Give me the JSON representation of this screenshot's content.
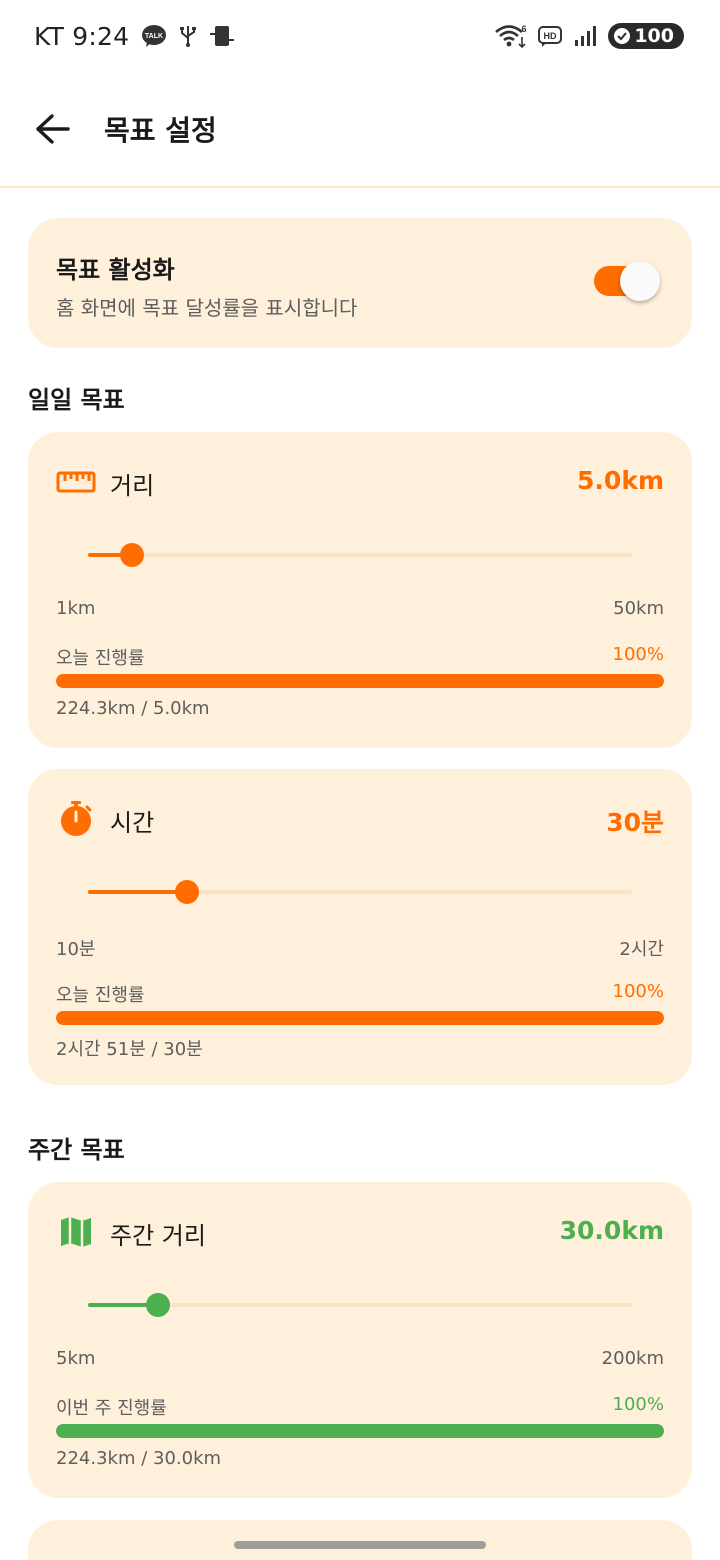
{
  "status_bar": {
    "time": "KT 9:24",
    "battery": "100",
    "network_badge": "HD",
    "wifi_superscript": "6",
    "icons": [
      "kakaotalk-icon",
      "usb-icon",
      "screen-cast-icon",
      "wifi-icon",
      "hd-voice-icon",
      "signal-icon",
      "battery-icon"
    ]
  },
  "app_bar": {
    "title": "목표 설정",
    "back_icon": "arrow-left-icon"
  },
  "toggle": {
    "title": "목표 활성화",
    "description": "홈 화면에 목표 달성률을 표시합니다",
    "enabled": true
  },
  "sections": {
    "daily_title": "일일 목표",
    "weekly_title": "주간 목표"
  },
  "colors": {
    "accent": "#ff6d00",
    "weekly": "#4caf50",
    "card_bg": "#fff0db",
    "track": "#fde4c0"
  },
  "goals": [
    {
      "icon": "ruler-icon",
      "label": "거리",
      "value": "5.0km",
      "slider_fraction": 0.0816,
      "min": "1km",
      "max": "50km",
      "progress_label": "오늘 진행률",
      "progress_percent": "100%",
      "progress_fraction": 1.0,
      "progress_detail": "224.3km / 5.0km"
    },
    {
      "icon": "stopwatch-icon",
      "label": "시간",
      "value": "30분",
      "slider_fraction": 0.1818,
      "min": "10분",
      "max": "2시간",
      "progress_label": "오늘 진행률",
      "progress_percent": "100%",
      "progress_fraction": 1.0,
      "progress_detail": "2시간 51분 / 30분"
    },
    {
      "icon": "map-icon",
      "label": "주간 거리",
      "value": "30.0km",
      "slider_fraction": 0.1282,
      "min": "5km",
      "max": "200km",
      "progress_label": "이번 주 진행률",
      "progress_percent": "100%",
      "progress_fraction": 1.0,
      "progress_detail": "224.3km / 30.0km"
    }
  ]
}
